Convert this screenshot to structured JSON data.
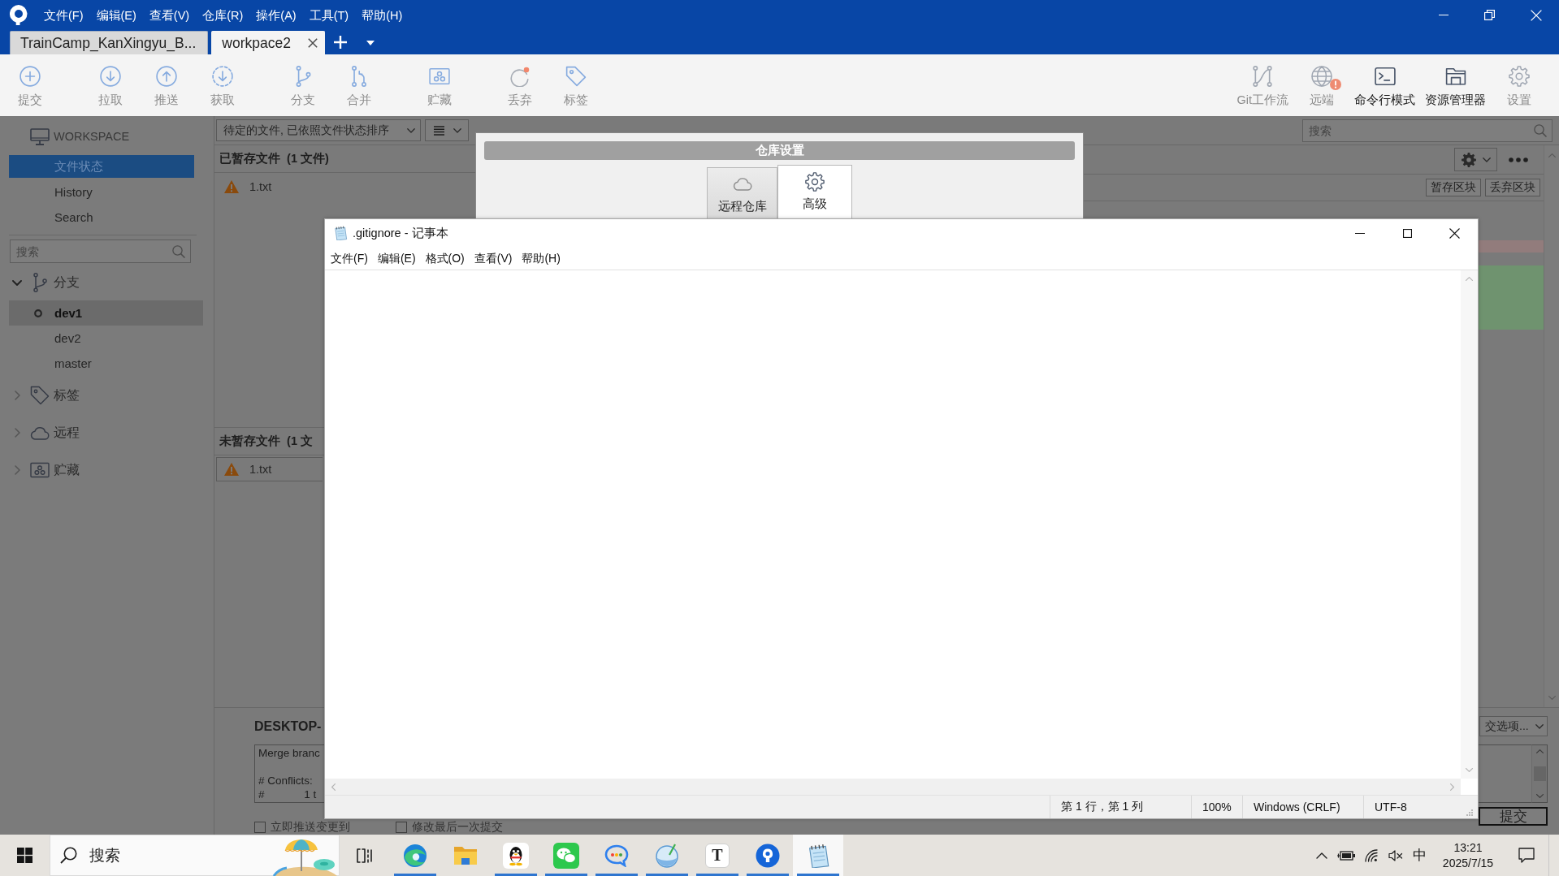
{
  "app": {
    "menu": [
      "文件(F)",
      "编辑(E)",
      "查看(V)",
      "仓库(R)",
      "操作(A)",
      "工具(T)",
      "帮助(H)"
    ],
    "tabs": [
      {
        "label": "TrainCamp_KanXingyu_B...",
        "selected": false
      },
      {
        "label": "workpace2",
        "selected": true
      }
    ]
  },
  "toolbar": {
    "action_groups": [
      [
        {
          "label": "提交",
          "kind": "commit",
          "disabled": true
        }
      ],
      [
        {
          "label": "拉取",
          "kind": "pull",
          "disabled": true
        },
        {
          "label": "推送",
          "kind": "push",
          "disabled": true
        },
        {
          "label": "获取",
          "kind": "fetch",
          "disabled": true
        }
      ],
      [
        {
          "label": "分支",
          "kind": "branch",
          "disabled": true
        },
        {
          "label": "合并",
          "kind": "merge",
          "disabled": true
        }
      ],
      [
        {
          "label": "贮藏",
          "kind": "stash",
          "disabled": true
        }
      ],
      [
        {
          "label": "丢弃",
          "kind": "discard",
          "disabled": true
        },
        {
          "label": "标签",
          "kind": "tag",
          "disabled": true
        }
      ]
    ],
    "tools": [
      {
        "label": "Git工作流",
        "kind": "gitflow",
        "disabled": true,
        "alert": false
      },
      {
        "label": "远端",
        "kind": "remote",
        "disabled": true,
        "alert": true
      },
      {
        "label": "命令行模式",
        "kind": "terminal",
        "disabled": false,
        "alert": false
      },
      {
        "label": "资源管理器",
        "kind": "explorer",
        "disabled": false,
        "alert": false
      },
      {
        "label": "设置",
        "kind": "settings",
        "disabled": true,
        "alert": false
      }
    ]
  },
  "sidebar": {
    "workspace": {
      "title": "WORKSPACE",
      "items": [
        {
          "label": "文件状态",
          "selected": true
        },
        {
          "label": "History",
          "selected": false
        },
        {
          "label": "Search",
          "selected": false
        }
      ]
    },
    "search": {
      "placeholder": "搜索"
    },
    "groups": [
      {
        "label": "分支",
        "kind": "branches",
        "expanded": true,
        "children": [
          {
            "label": "dev1",
            "current": true
          },
          {
            "label": "dev2",
            "current": false
          },
          {
            "label": "master",
            "current": false
          }
        ]
      },
      {
        "label": "标签",
        "kind": "tags",
        "expanded": false
      },
      {
        "label": "远程",
        "kind": "remotes",
        "expanded": false
      },
      {
        "label": "贮藏",
        "kind": "stashes",
        "expanded": false
      }
    ]
  },
  "files": {
    "sort": "待定的文件, 已依照文件状态排序",
    "sections": [
      {
        "title": "已暂存文件  (1 文件)",
        "files": [
          {
            "name": "1.txt",
            "kind": "conflict",
            "selected": false
          }
        ]
      },
      {
        "title": "未暂存文件  (1 文",
        "files": [
          {
            "name": "1.txt",
            "kind": "conflict",
            "selected": true
          }
        ]
      }
    ]
  },
  "diff": {
    "search": {
      "placeholder": "搜索"
    },
    "hunk_buttons": [
      "暂存区块",
      "丢弃区块"
    ]
  },
  "commit": {
    "author": "DESKTOP-",
    "options_menu": "交选项...",
    "message": "Merge branc\n\n# Conflicts:\n#\t1 t",
    "options": [
      {
        "label": "立即推送变更到",
        "checked": false
      },
      {
        "label": "修改最后一次提交",
        "checked": false
      }
    ],
    "button": "提交"
  },
  "repo_settings": {
    "title": "仓库设置",
    "tabs": [
      {
        "label": "远程仓库",
        "kind": "remote",
        "selected": false
      },
      {
        "label": "高级",
        "kind": "advanced",
        "selected": true
      }
    ]
  },
  "notepad": {
    "title": ".gitignore - 记事本",
    "menu": [
      "文件(F)",
      "编辑(E)",
      "格式(O)",
      "查看(V)",
      "帮助(H)"
    ],
    "status": [
      "第 1 行，第 1 列",
      "100%",
      "Windows (CRLF)",
      "UTF-8"
    ]
  },
  "taskbar": {
    "search": {
      "placeholder": "搜索"
    },
    "apps": [
      {
        "kind": "task-view",
        "running": false,
        "active": false
      },
      {
        "kind": "swirl",
        "running": true,
        "active": false
      },
      {
        "kind": "folder",
        "running": false,
        "active": false
      },
      {
        "kind": "penguin",
        "running": true,
        "active": false
      },
      {
        "kind": "chat",
        "running": true,
        "active": false
      },
      {
        "kind": "speech",
        "running": true,
        "active": false
      },
      {
        "kind": "glass-ball",
        "running": true,
        "active": false
      },
      {
        "kind": "letter",
        "glyph": "T",
        "running": true,
        "active": false
      },
      {
        "kind": "pin",
        "running": true,
        "active": false
      },
      {
        "kind": "notepad",
        "running": true,
        "active": true
      }
    ],
    "ime": "中",
    "time": "13:21",
    "date": "2025/7/15"
  }
}
